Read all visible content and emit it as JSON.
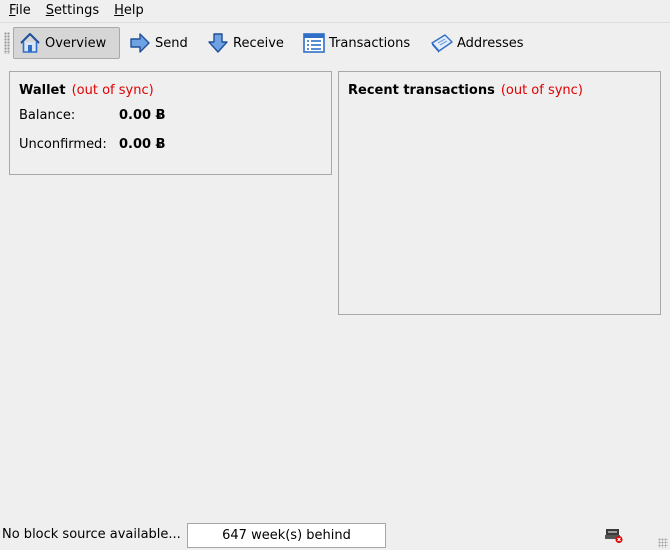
{
  "menu": {
    "file": {
      "mnemonic": "F",
      "rest": "ile"
    },
    "settings": {
      "mnemonic": "S",
      "rest": "ettings"
    },
    "help": {
      "mnemonic": "H",
      "rest": "elp"
    }
  },
  "toolbar": {
    "overview": "Overview",
    "send": "Send",
    "receive": "Receive",
    "transactions": "Transactions",
    "addresses": "Addresses"
  },
  "wallet": {
    "title": "Wallet",
    "sync_status": "(out of sync)",
    "balance_label": "Balance:",
    "balance_value": "0.00 Ƀ",
    "unconfirmed_label": "Unconfirmed:",
    "unconfirmed_value": "0.00 Ƀ"
  },
  "recent": {
    "title": "Recent transactions",
    "sync_status": "(out of sync)"
  },
  "status": {
    "message": "No block source available...",
    "progress_text": "647 week(s) behind"
  },
  "colors": {
    "out_of_sync": "#e00000",
    "icon_blue": "#2f6fc7"
  }
}
